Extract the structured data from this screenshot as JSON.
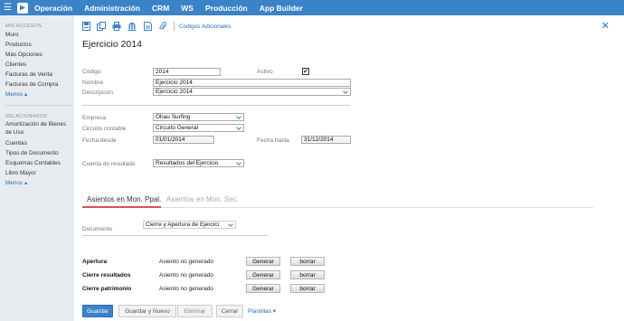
{
  "topnav": {
    "items": [
      "Operación",
      "Administración",
      "CRM",
      "WS",
      "Producción",
      "App Builder"
    ]
  },
  "sidebar": {
    "section1": "MIS ACCESOS",
    "items1": [
      "Muro",
      "Productos",
      "Más Opciones",
      "Clientes",
      "Facturas de Venta",
      "Facturas de Compra"
    ],
    "more1": "Menos ▴",
    "section2": "RELACIONADOS",
    "items2": [
      "Amortización de Bienes de Uso",
      "Cuentas",
      "Tipos de Documento",
      "Esquemas Contables",
      "Libro Mayor"
    ],
    "more2": "Menos ▴"
  },
  "toolbar": {
    "link": "Codigos Adicionales"
  },
  "form": {
    "title": "Ejercicio 2014",
    "codigo_label": "Código",
    "codigo_value": "2014",
    "activo_label": "Activo",
    "activo_checked": "✔",
    "nombre_label": "Nombre",
    "nombre_value": "Ejercicio 2014",
    "descripcion_label": "Descripción",
    "descripcion_value": "Ejercicio 2014",
    "empresa_label": "Empresa",
    "empresa_value": "Ohau Surfing",
    "circuito_label": "Circuito contable",
    "circuito_value": "Circuito General",
    "fecha_desde_label": "Fecha desde",
    "fecha_desde_value": "01/01/2014",
    "fecha_hasta_label": "Fecha hasta",
    "fecha_hasta_value": "31/12/2014",
    "cuenta_label": "Cuenta de resultado",
    "cuenta_value": "Resultados del Ejercicio"
  },
  "tabs": {
    "active": "Asientos en Mon. Ppal.",
    "inactive": "Asientos en Mon. Sec."
  },
  "documento": {
    "label": "Documento",
    "value": "Cierre y Apertura de Ejercici"
  },
  "rows": [
    {
      "label": "Apertura",
      "status": "Asiento no generado",
      "gen": "Generar",
      "del": "borrar"
    },
    {
      "label": "Cierre resultados",
      "status": "Asiento no generado",
      "gen": "Generar",
      "del": "borrar"
    },
    {
      "label": "Cierre patrimonio",
      "status": "Asiento no generado",
      "gen": "Generar",
      "del": "borrar"
    }
  ],
  "footer": {
    "guardar": "Guardar",
    "guardar_nuevo": "Guardar y Nuevo",
    "eliminar": "Eliminar",
    "cerrar": "Cerrar",
    "plantillas": "Plantillas ▾"
  },
  "colors": {
    "primary": "#3a83c8",
    "tab_accent": "#d9534f"
  }
}
